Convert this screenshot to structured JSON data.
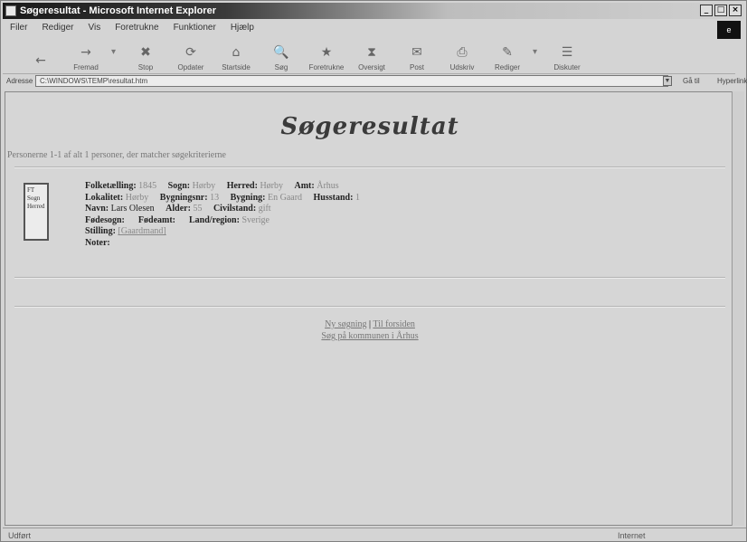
{
  "window": {
    "title": "Søgeresultat - Microsoft Internet Explorer",
    "controls": [
      "_",
      "□",
      "×"
    ]
  },
  "menu": [
    "Filer",
    "Rediger",
    "Vis",
    "Foretrukne",
    "Funktioner",
    "Hjælp"
  ],
  "toolbar": {
    "back_glyph": "←",
    "items": [
      {
        "label": "Fremad",
        "icon": "→"
      },
      {
        "label": "Stop",
        "icon": "✖"
      },
      {
        "label": "Opdater",
        "icon": "⟳"
      },
      {
        "label": "Startside",
        "icon": "⌂"
      },
      {
        "label": "Søg",
        "icon": "🔍"
      },
      {
        "label": "Foretrukne",
        "icon": "★"
      },
      {
        "label": "Oversigt",
        "icon": "⧗"
      },
      {
        "label": "Post",
        "icon": "✉"
      },
      {
        "label": "Udskriv",
        "icon": "⎙"
      },
      {
        "label": "Rediger",
        "icon": "✎"
      },
      {
        "label": "Diskuter",
        "icon": "☰"
      }
    ]
  },
  "address": {
    "label": "Adresse",
    "value": "C:\\WINDOWS\\TEMP\\resultat.htm",
    "go_label": "Gå til",
    "links_label": "Hyperlinks"
  },
  "page": {
    "title": "Søgeresultat",
    "summary": "Personerne 1-1 af alt 1 personer, der matcher søgekriterierne",
    "record": {
      "icon_text": [
        "FT",
        "Sogn",
        "Herred"
      ],
      "line1": [
        {
          "label": "Folketælling:",
          "value": "1845"
        },
        {
          "label": "Sogn:",
          "value": "Hørby"
        },
        {
          "label": "Herred:",
          "value": "Hørby"
        },
        {
          "label": "Amt:",
          "value": "Århus"
        }
      ],
      "line2": [
        {
          "label": "Lokalitet:",
          "value": "Hørby"
        },
        {
          "label": "Bygningsnr:",
          "value": "13"
        },
        {
          "label": "Bygning:",
          "value": "En Gaard"
        },
        {
          "label": "Husstand:",
          "value": "1"
        }
      ],
      "line3": [
        {
          "label": "Navn:",
          "value": "Lars Olesen"
        },
        {
          "label": "Alder:",
          "value": "55"
        },
        {
          "label": "Civilstand:",
          "value": "gift"
        }
      ],
      "line4": [
        {
          "label": "Fødesogn:",
          "value": ""
        },
        {
          "label": "Fødeamt:",
          "value": ""
        },
        {
          "label": "Land/region:",
          "value": "Sverige"
        }
      ],
      "line5": {
        "label": "Stilling:",
        "value": "[Gaardmand]"
      },
      "line6": {
        "label": "Noter:",
        "value": ""
      }
    },
    "footer": {
      "link1": "Ny søgning",
      "separator": "|",
      "link2": "Til forsiden",
      "link3": "Søg på kommunen i Århus"
    }
  },
  "status": {
    "left": "Udført",
    "right": "Internet"
  }
}
